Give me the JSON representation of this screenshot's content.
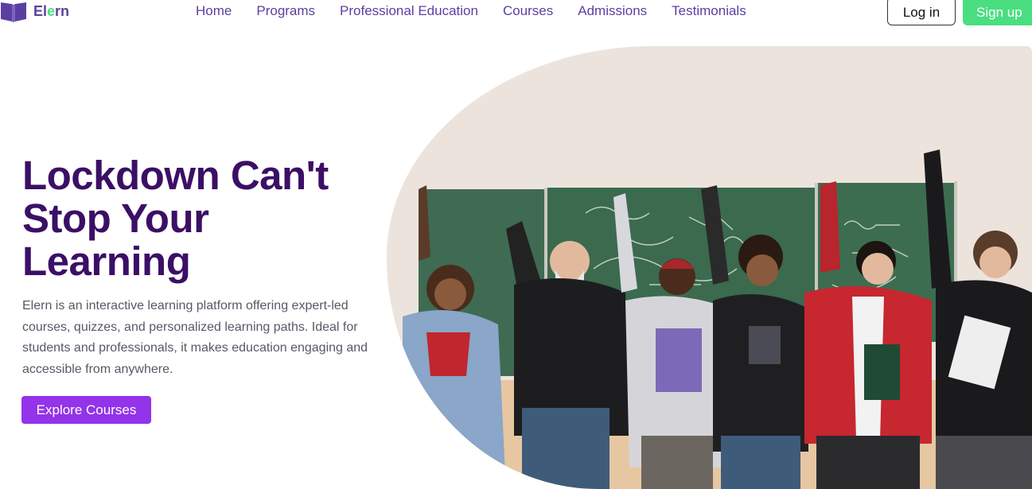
{
  "header": {
    "logo": {
      "icon": "open-book-icon",
      "text_before": "El",
      "text_accent": "e",
      "text_after": "rn"
    },
    "nav": [
      {
        "label": "Home"
      },
      {
        "label": "Programs"
      },
      {
        "label": "Professional Education"
      },
      {
        "label": "Courses"
      },
      {
        "label": "Admissions"
      },
      {
        "label": "Testimonials"
      }
    ],
    "login_label": "Log in",
    "signup_label": "Sign up"
  },
  "hero": {
    "title_line1": "Lockdown Can't",
    "title_line2": "Stop Your",
    "title_line3": "Learning",
    "description": "Elern is an interactive learning platform offering expert-led courses, quizzes, and personalized learning paths. Ideal for students and professionals, it makes education engaging and accessible from anywhere.",
    "cta_label": "Explore Courses"
  },
  "colors": {
    "brand_purple": "#5b3fa0",
    "heading": "#3b0f66",
    "accent_green": "#4ade80",
    "cta_purple": "#9333ea"
  }
}
